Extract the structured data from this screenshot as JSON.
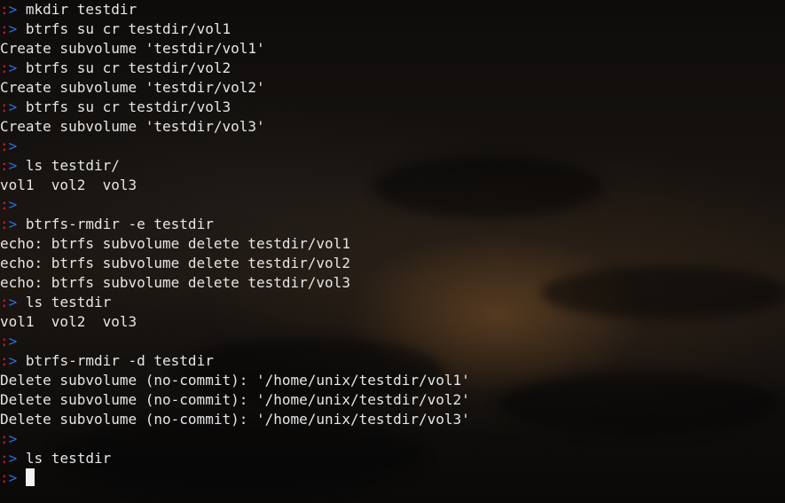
{
  "prompt": {
    "colon": ":",
    "arrow": "> "
  },
  "lines": [
    {
      "type": "cmd",
      "text": "mkdir testdir"
    },
    {
      "type": "cmd",
      "text": "btrfs su cr testdir/vol1"
    },
    {
      "type": "out",
      "text": "Create subvolume 'testdir/vol1'"
    },
    {
      "type": "cmd",
      "text": "btrfs su cr testdir/vol2"
    },
    {
      "type": "out",
      "text": "Create subvolume 'testdir/vol2'"
    },
    {
      "type": "cmd",
      "text": "btrfs su cr testdir/vol3"
    },
    {
      "type": "out",
      "text": "Create subvolume 'testdir/vol3'"
    },
    {
      "type": "cmd",
      "text": ""
    },
    {
      "type": "cmd",
      "text": "ls testdir/"
    },
    {
      "type": "out",
      "text": "vol1  vol2  vol3"
    },
    {
      "type": "cmd",
      "text": ""
    },
    {
      "type": "cmd",
      "text": "btrfs-rmdir -e testdir"
    },
    {
      "type": "out",
      "text": "echo: btrfs subvolume delete testdir/vol1"
    },
    {
      "type": "out",
      "text": "echo: btrfs subvolume delete testdir/vol2"
    },
    {
      "type": "out",
      "text": "echo: btrfs subvolume delete testdir/vol3"
    },
    {
      "type": "cmd",
      "text": "ls testdir"
    },
    {
      "type": "out",
      "text": "vol1  vol2  vol3"
    },
    {
      "type": "cmd",
      "text": ""
    },
    {
      "type": "cmd",
      "text": "btrfs-rmdir -d testdir"
    },
    {
      "type": "out",
      "text": "Delete subvolume (no-commit): '/home/unix/testdir/vol1'"
    },
    {
      "type": "out",
      "text": "Delete subvolume (no-commit): '/home/unix/testdir/vol2'"
    },
    {
      "type": "out",
      "text": "Delete subvolume (no-commit): '/home/unix/testdir/vol3'"
    },
    {
      "type": "cmd",
      "text": ""
    },
    {
      "type": "cmd",
      "text": "ls testdir"
    },
    {
      "type": "input",
      "text": ""
    }
  ],
  "colors": {
    "prompt_colon": "#d21b3b",
    "prompt_arrow": "#2a6fe0",
    "text": "#e6e6e6",
    "cursor": "#f2f2f2"
  }
}
